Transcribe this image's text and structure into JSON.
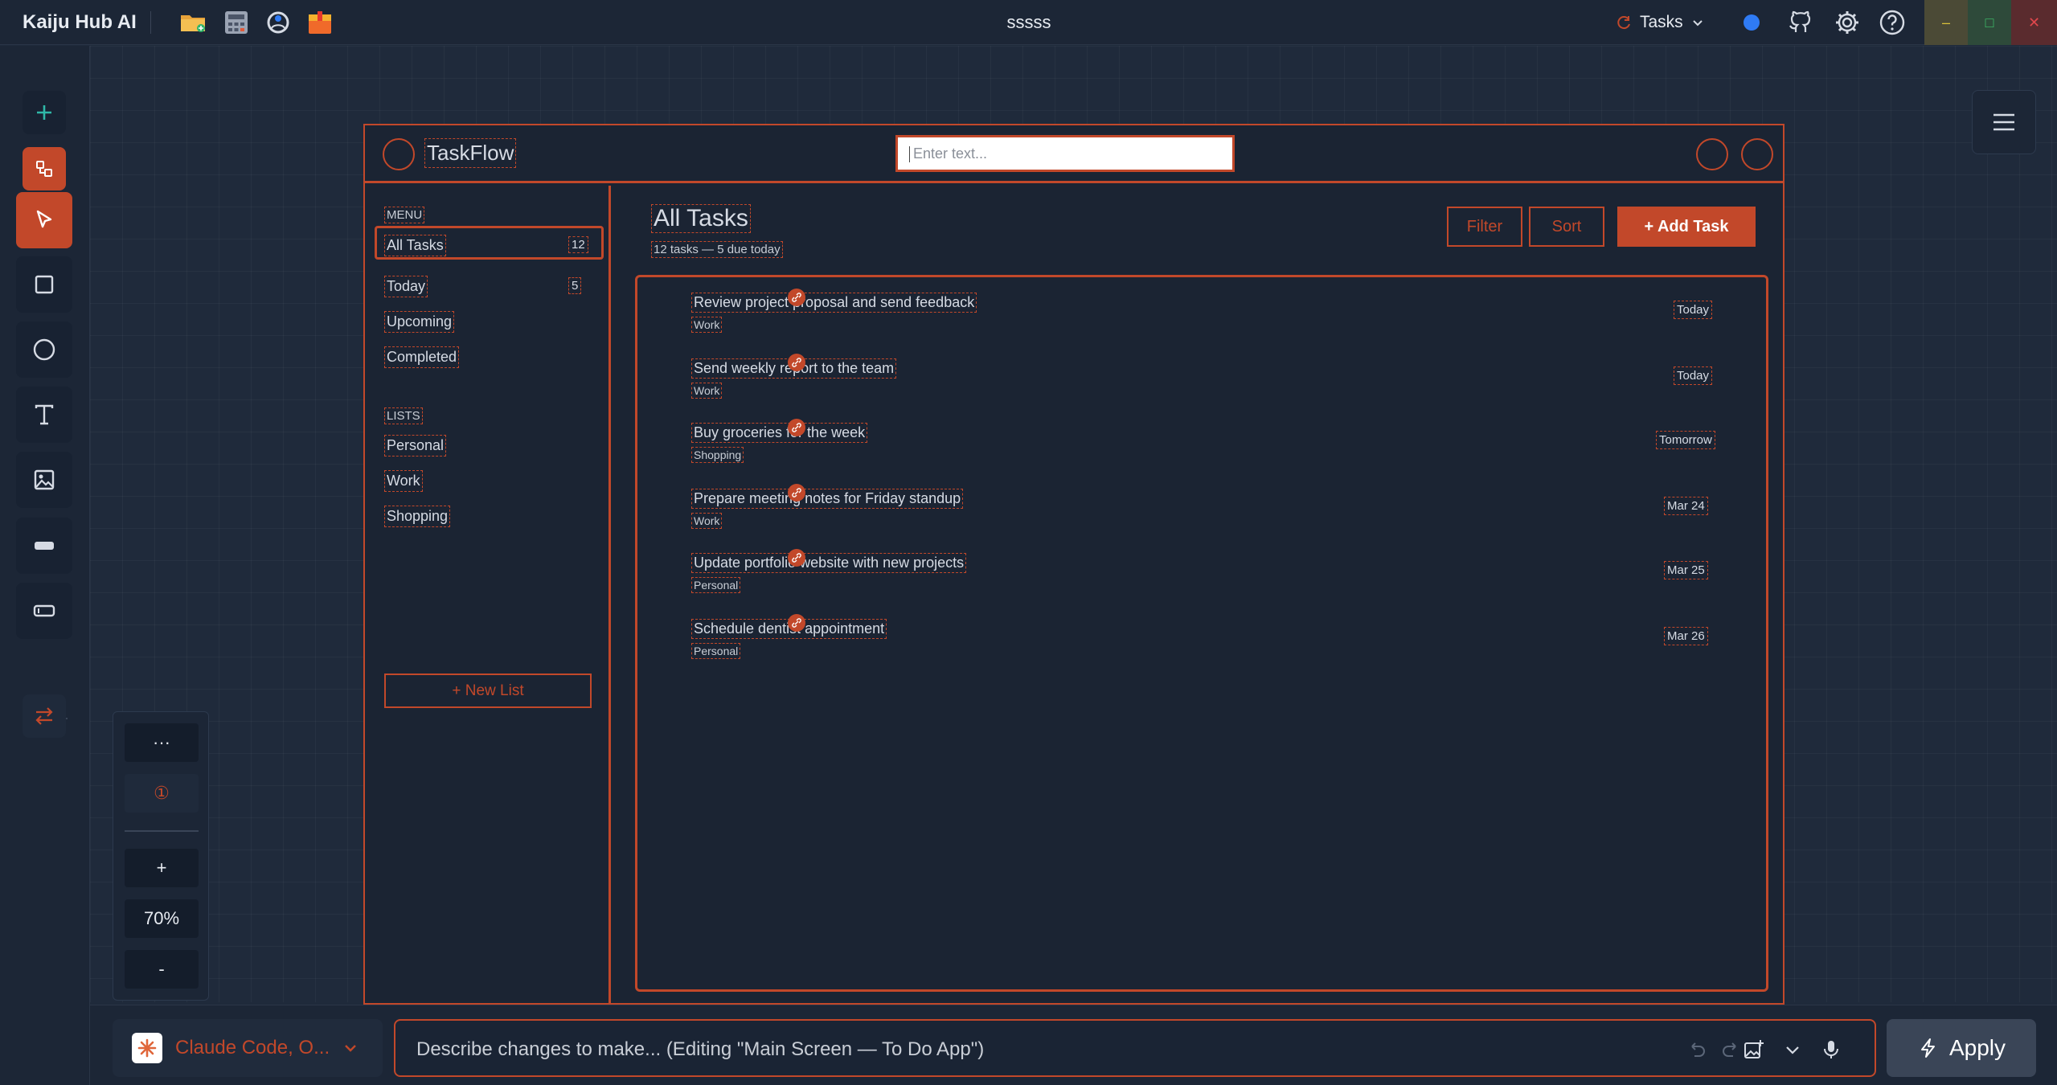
{
  "app": {
    "title": "Kaiju Hub AI",
    "document_title": "sssss",
    "tasks_dropdown": "Tasks",
    "win_min": "–",
    "win_max": "□",
    "win_close": "✕"
  },
  "zoom": {
    "more_label": "···",
    "alert_label": "①",
    "zoom_in_label": "+",
    "zoom_level": "70%",
    "zoom_out_label": "-"
  },
  "design": {
    "brand": "TaskFlow",
    "search_placeholder": "Enter text...",
    "sidebar": {
      "menu_label": "MENU",
      "menu_items": [
        {
          "label": "All Tasks",
          "count": "12"
        },
        {
          "label": "Today",
          "count": "5"
        },
        {
          "label": "Upcoming"
        },
        {
          "label": "Completed"
        }
      ],
      "lists_label": "LISTS",
      "lists": [
        "Personal",
        "Work",
        "Shopping"
      ],
      "new_list": "+ New List"
    },
    "main": {
      "title": "All Tasks",
      "subtitle": "12 tasks — 5 due today",
      "filter": "Filter",
      "sort": "Sort",
      "add_task": "+ Add Task"
    },
    "tasks": [
      {
        "title": "Review project proposal and send feedback",
        "tag": "Work",
        "due": "Today"
      },
      {
        "title": "Send weekly report to the team",
        "tag": "Work",
        "due": "Today"
      },
      {
        "title": "Buy groceries for the week",
        "tag": "Shopping",
        "due": "Tomorrow"
      },
      {
        "title": "Prepare meeting notes for Friday standup",
        "tag": "Work",
        "due": "Mar 24"
      },
      {
        "title": "Update portfolio website with new projects",
        "tag": "Personal",
        "due": "Mar 25"
      },
      {
        "title": "Schedule dentist appointment",
        "tag": "Personal",
        "due": "Mar 26"
      }
    ]
  },
  "bottom": {
    "model": "Claude Code, O...",
    "prompt_placeholder": "Describe changes to make... (Editing \"Main Screen — To Do App\")",
    "apply": "Apply"
  },
  "colors": {
    "accent": "#c2482a",
    "background": "#1f2a3b",
    "panel": "#1c2636",
    "status_dot": "#2f7bf5"
  }
}
